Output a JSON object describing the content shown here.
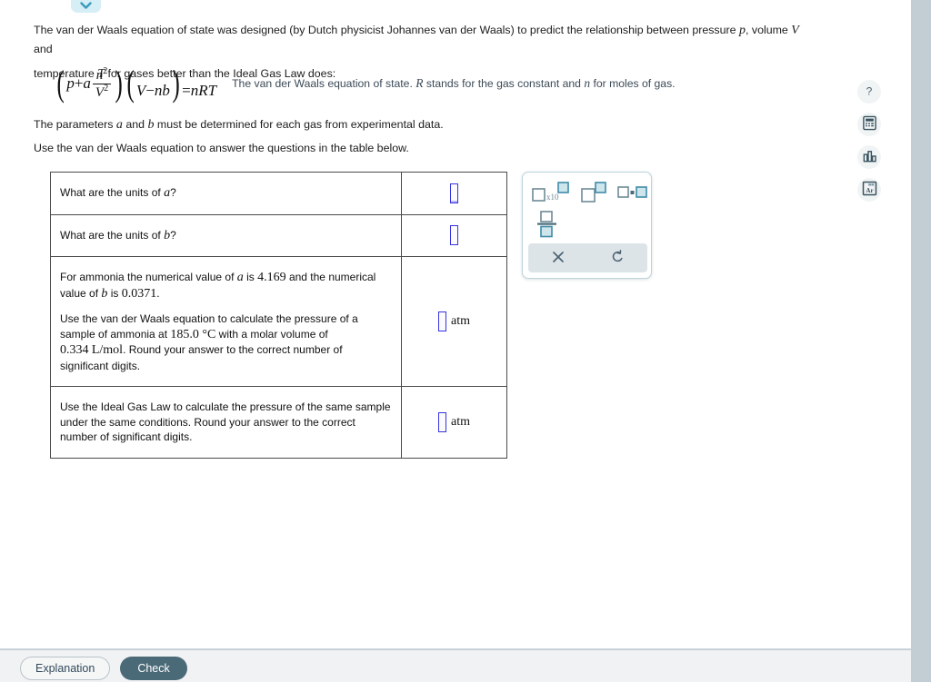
{
  "window": {
    "background_color": "#c3ced4",
    "card_background": "#ffffff"
  },
  "collapse_tab": {
    "icon": "chevron-down-icon",
    "color": "#2e7b93"
  },
  "intro": {
    "line1_a": "The van der Waals equation of state was designed (by Dutch physicist Johannes van der Waals) to predict the relationship between pressure ",
    "var_p": "p",
    "line1_b": ", volume ",
    "var_V": "V",
    "line1_c": " and",
    "line2_a": "temperature ",
    "var_T": "T",
    "line2_b": " for gases better than the Ideal Gas Law does:"
  },
  "equation": {
    "lparen": "(",
    "rparen": ")",
    "p": "p",
    "plus": "+",
    "a": "a",
    "numerator": "n",
    "numerator_exp": "2",
    "denominator": "V",
    "denominator_exp": "2",
    "tail": "(V−nb)=nRT",
    "V": "V",
    "minus": "−",
    "n1": "n",
    "b": "b",
    "equals": "=",
    "n2": "n",
    "R": "R",
    "T": "T",
    "caption_a": "The van der Waals equation of state. ",
    "caption_R": "R",
    "caption_b": " stands for the gas constant and ",
    "caption_n": "n",
    "caption_c": " for moles of gas."
  },
  "paragraphs": {
    "params_a": "The parameters ",
    "params_var_a": "a",
    "params_b": " and ",
    "params_var_b": "b",
    "params_c": " must be determined for each gas from experimental data.",
    "instruction": "Use the van der Waals equation to answer the questions in the table below."
  },
  "table": {
    "rows": [
      {
        "id": "units-of-a",
        "question_prefix": "What are the units of ",
        "question_var": "a",
        "question_suffix": "?",
        "answer_value": "",
        "unit": ""
      },
      {
        "id": "units-of-b",
        "question_prefix": "What are the units of ",
        "question_var": "b",
        "question_suffix": "?",
        "answer_value": "",
        "unit": ""
      },
      {
        "id": "vdw-pressure",
        "para1_a": "For ammonia the numerical value of ",
        "para1_var_a": "a",
        "para1_b": " is ",
        "para1_val_a": "4.169",
        "para1_c": " and the numerical value of ",
        "para1_var_b": "b",
        "para1_d": " is ",
        "para1_val_b": "0.0371",
        "para1_e": ".",
        "para2_a": "Use the van der Waals equation to calculate the pressure of a sample of ammonia at ",
        "para2_temp": "185.0 °C",
        "para2_b": " with a molar volume of ",
        "para2_volume": "0.334",
        "para2_volume_unit": "L/mol",
        "para2_c": ". Round your answer to the correct number of significant digits.",
        "answer_value": "",
        "unit": "atm"
      },
      {
        "id": "ideal-gas-pressure",
        "text": "Use the Ideal Gas Law to calculate the pressure of the same sample under the same conditions. Round your answer to the correct number of significant digits.",
        "answer_value": "",
        "unit": "atm"
      }
    ]
  },
  "math_palette": {
    "buttons": [
      {
        "name": "scientific-notation-button",
        "label": "□×10□"
      },
      {
        "name": "superscript-button",
        "label": "□^□"
      },
      {
        "name": "multiplication-button",
        "label": "□·□"
      },
      {
        "name": "fraction-button",
        "label": "□/□"
      }
    ],
    "actions": [
      {
        "name": "clear-button",
        "icon": "close-icon"
      },
      {
        "name": "undo-button",
        "icon": "undo-icon"
      }
    ],
    "accent_color": "#3d8ca8",
    "fill_color": "#cfe5ec"
  },
  "tool_rail": {
    "items": [
      {
        "name": "help-button",
        "icon": "question-mark-icon",
        "label": "?"
      },
      {
        "name": "calculator-button",
        "icon": "calculator-icon"
      },
      {
        "name": "data-chart-button",
        "icon": "bar-chart-icon"
      },
      {
        "name": "periodic-table-button",
        "icon": "periodic-table-icon",
        "label": "Ar"
      }
    ]
  },
  "footer": {
    "explanation_label": "Explanation",
    "check_label": "Check",
    "check_color": "#4b6a78"
  }
}
